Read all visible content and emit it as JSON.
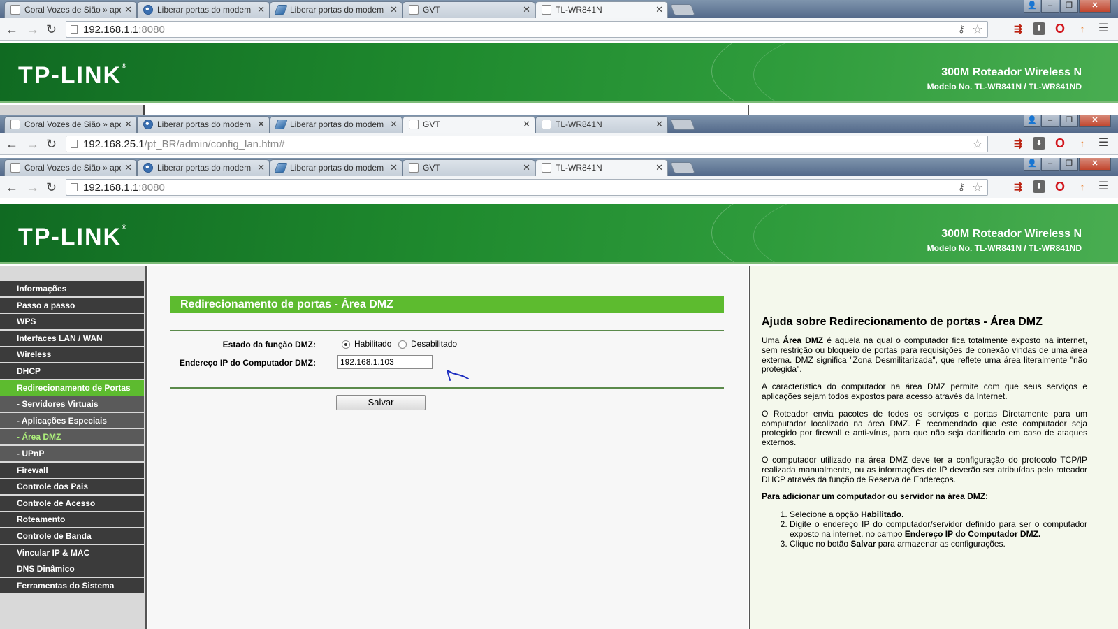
{
  "browser_top": {
    "tabs": [
      {
        "title": "Coral Vozes de Sião » apo",
        "icon": "page-icon"
      },
      {
        "title": "Liberar portas do modem",
        "icon": "globe-icon"
      },
      {
        "title": "Liberar portas do modem",
        "icon": "gvt-icon"
      },
      {
        "title": "GVT",
        "icon": "page-icon"
      },
      {
        "title": "TL-WR841N",
        "icon": "page-icon"
      }
    ],
    "url_main": "192.168.1.1",
    "url_dim": ":8080"
  },
  "browser_mid": {
    "url_main": "192.168.25.1",
    "url_dim": "/pt_BR/admin/config_lan.htm#"
  },
  "router": {
    "logo": "TP-LINK",
    "product": "300M Roteador Wireless N",
    "model": "Modelo No. TL-WR841N / TL-WR841ND"
  },
  "nav": [
    "Informações",
    "Passo a passo",
    "WPS",
    "Interfaces LAN / WAN",
    "Wireless",
    "DHCP",
    "Redirecionamento de Portas",
    "- Servidores Virtuais",
    "- Aplicações Especiais",
    "- Área DMZ",
    "- UPnP",
    "Firewall",
    "Controle dos Pais",
    "Controle de Acesso",
    "Roteamento",
    "Controle de Banda",
    "Vincular IP & MAC",
    "DNS Dinâmico",
    "Ferramentas do Sistema"
  ],
  "main": {
    "title": "Redirecionamento de portas - Área DMZ",
    "dmz_state_label": "Estado da função DMZ:",
    "enabled_label": "Habilitado",
    "disabled_label": "Desabilitado",
    "ip_label": "Endereço IP do Computador DMZ:",
    "ip_value": "192.168.1.103",
    "save_label": "Salvar"
  },
  "help": {
    "title": "Ajuda sobre Redirecionamento de portas - Área DMZ",
    "p1_a": "Uma ",
    "p1_b": "Área DMZ",
    "p1_c": " é aquela na qual o computador fica totalmente exposto na internet, sem restrição ou bloqueio de portas para requisições de conexão vindas de uma área externa. DMZ significa \"Zona Desmilitarizada\", que reflete uma área literalmente \"não protegida\".",
    "p2": "A característica do computador na área DMZ permite com que seus serviços e aplicações sejam todos expostos para acesso através da Internet.",
    "p3": "O Roteador envia pacotes de todos os serviços e portas Diretamente para um computador localizado na área DMZ. É recomendado que este computador seja protegido por firewall e anti-vírus, para que não seja danificado em caso de ataques externos.",
    "p4": "O computador utilizado na área DMZ deve ter a configuração do protocolo TCP/IP realizada manualmente, ou as informações de IP deverão ser atribuídas pelo roteador DHCP através da função de Reserva de Endereços.",
    "p5_bold": "Para adicionar um computador ou servidor na área DMZ",
    "p5_colon": ":",
    "step1_a": "Selecione a opção ",
    "step1_b": "Habilitado.",
    "step2_a": "Digite o endereço IP do computador/servidor definido para ser o computador exposto na internet, no campo ",
    "step2_b": "Endereço IP do Computador DMZ.",
    "step3_a": "Clique no botão ",
    "step3_b": "Salvar",
    "step3_c": " para armazenar as configurações."
  },
  "colors": {
    "green_header": "#1f8a2e",
    "green_accent": "#5dbb2f",
    "nav_dark": "#3b3b3b"
  }
}
